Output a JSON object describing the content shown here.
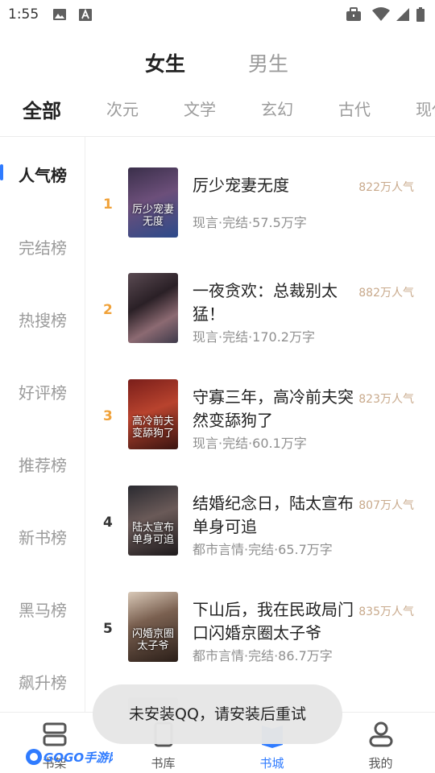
{
  "status_bar": {
    "time": "1:55",
    "left_icons": [
      "image-icon",
      "text-a-icon"
    ],
    "right_icons": [
      "briefcase-icon",
      "wifi-icon",
      "signal-icon",
      "battery-icon"
    ]
  },
  "gender_tabs": [
    {
      "label": "女生",
      "active": true
    },
    {
      "label": "男生",
      "active": false
    }
  ],
  "categories": [
    {
      "label": "全部",
      "active": true
    },
    {
      "label": "次元"
    },
    {
      "label": "文学"
    },
    {
      "label": "玄幻"
    },
    {
      "label": "古代"
    },
    {
      "label": "现代"
    }
  ],
  "sidebar": [
    {
      "label": "人气榜",
      "active": true
    },
    {
      "label": "完结榜"
    },
    {
      "label": "热搜榜"
    },
    {
      "label": "好评榜"
    },
    {
      "label": "推荐榜"
    },
    {
      "label": "新书榜"
    },
    {
      "label": "黑马榜"
    },
    {
      "label": "飙升榜"
    }
  ],
  "books": [
    {
      "rank": "1",
      "title": "厉少宠妻无度",
      "meta": "现言·完结·57.5万字",
      "popularity": "822万人气",
      "cover_text": "厉少宠妻无度"
    },
    {
      "rank": "2",
      "title": "一夜贪欢：总裁别太猛！",
      "meta": "现言·完结·170.2万字",
      "popularity": "882万人气",
      "cover_text": ""
    },
    {
      "rank": "3",
      "title": "守寡三年，高冷前夫突然变舔狗了",
      "meta": "现言·完结·60.1万字",
      "popularity": "823万人气",
      "cover_text": "高冷前夫变舔狗了"
    },
    {
      "rank": "4",
      "title": "结婚纪念日，陆太宣布单身可追",
      "meta": "都市言情·完结·65.7万字",
      "popularity": "807万人气",
      "cover_text": "陆太宣布单身可追"
    },
    {
      "rank": "5",
      "title": "下山后，我在民政局门口闪婚京圈太子爷",
      "meta": "都市言情·完结·86.7万字",
      "popularity": "835万人气",
      "cover_text": "闪婚京圈太子爷"
    }
  ],
  "colors": {
    "accent": "#2f7bff",
    "rank_top": "#f0a23a",
    "rank_normal": "#333333",
    "popularity": "#c8a98b"
  },
  "toast": "未安装QQ，请安装后重试",
  "bottom_nav": [
    {
      "label": "书架",
      "icon": "bookshelf-icon",
      "active": false
    },
    {
      "label": "书库",
      "icon": "library-icon",
      "active": false
    },
    {
      "label": "书城",
      "icon": "bookstore-icon",
      "active": true
    },
    {
      "label": "我的",
      "icon": "profile-icon",
      "active": false
    }
  ],
  "watermark": "GOGO手游网"
}
